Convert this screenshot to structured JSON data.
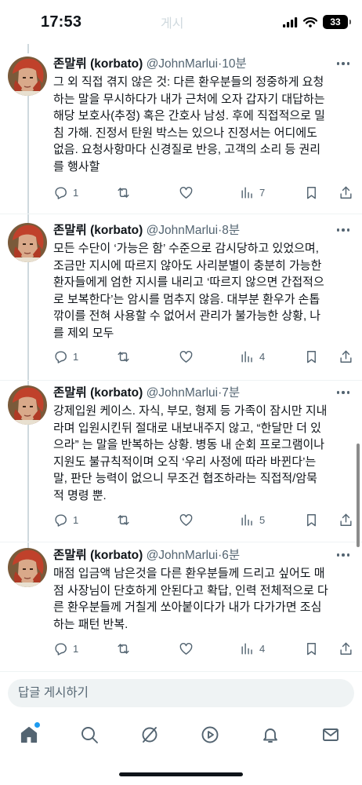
{
  "status_bar": {
    "time": "17:53",
    "ghost_title": "게시",
    "battery": "33"
  },
  "reply_placeholder": "답글 게시하기",
  "tweets": [
    {
      "name": "존말뤼 (korbato)",
      "handle": "@JohnMarlui",
      "time": "·10분",
      "text": "그 외 직접 겪지 않은 것: 다른 환우분들의 정중하게 요청\n하는 말을 무시하다가 내가 근처에 오자 갑자기 대답하는\n해당 보호사(추정) 혹은 간호사 남성. 후에 직접적으로 밀\n침 가해. 진정서 탄원 박스는 있으나 진정서는 어디에도\n없음. 요청사항마다 신경질로 반응, 고객의 소리 등 권리\n를 행사할",
      "replies": "1",
      "views": "7"
    },
    {
      "name": "존말뤼 (korbato)",
      "handle": "@JohnMarlui",
      "time": "·8분",
      "text": "모든 수단이 ‘가능은 함’ 수준으로 감시당하고 있었으며,\n조금만 지시에 따르지 않아도 사리분별이 충분히 가능한\n환자들에게 엄한 지시를 내리고 ‘따르지 않으면 간접적으\n로 보복한다’는 암시를 멈추지 않음. 대부분 환우가 손톱\n깎이를 전혀 사용할 수 없어서 관리가 불가능한 상황, 나\n를 제외 모두",
      "replies": "1",
      "views": "4"
    },
    {
      "name": "존말뤼 (korbato)",
      "handle": "@JohnMarlui",
      "time": "·7분",
      "text": "강제입원 케이스. 자식, 부모, 형제 등 가족이 잠시만 지내\n라며 입원시킨뒤 절대로 내보내주지 않고, “한달만 더 있\n으라” 는 말을 반복하는 상황. 병동 내 순회 프로그램이나\n지원도 불규칙적이며 오직 ‘우리 사정에 따라 바뀐다’는\n말, 판단 능력이 없으니 무조건 협조하라는 직접적/암묵\n적 명령 뿐.",
      "replies": "1",
      "views": "5"
    },
    {
      "name": "존말뤼 (korbato)",
      "handle": "@JohnMarlui",
      "time": "·6분",
      "text": "매점 입금액 남은것을 다른 환우분들께 드리고 싶어도 매\n점 사장님이 단호하게 안된다고 확답, 인력 전체적으로 다\n른 환우분들께 거칠게 쏘아붙이다가 내가 다가가면 조심\n하는 패턴 반복.",
      "replies": "1",
      "views": "4"
    }
  ]
}
